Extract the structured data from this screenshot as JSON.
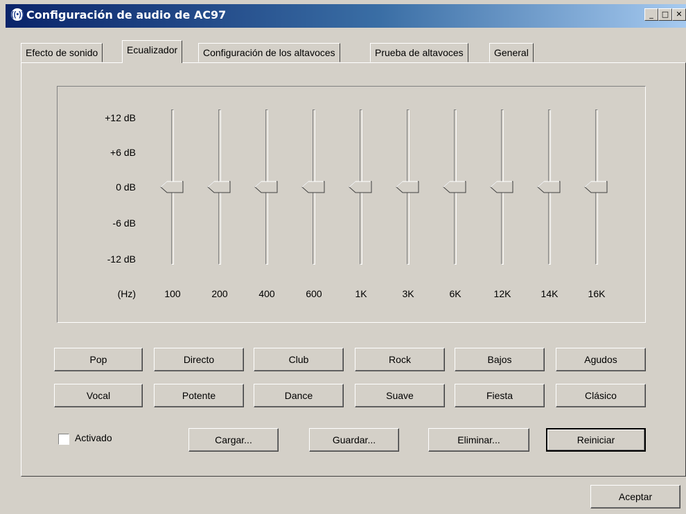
{
  "window": {
    "title": "Configuración de audio de AC97",
    "icon": "speaker-waves-icon"
  },
  "tabs": [
    {
      "label": "Efecto de sonido",
      "active": false
    },
    {
      "label": "Ecualizador",
      "active": true
    },
    {
      "label": "Configuración de los altavoces",
      "active": false
    },
    {
      "label": "Prueba de altavoces",
      "active": false
    },
    {
      "label": "General",
      "active": false
    }
  ],
  "equalizer": {
    "db_labels": [
      "+12 dB",
      "+6 dB",
      "0 dB",
      "-6 dB",
      "-12 dB"
    ],
    "hz_label": "(Hz)",
    "bands": [
      {
        "label": "100",
        "value_db": 0
      },
      {
        "label": "200",
        "value_db": 0
      },
      {
        "label": "400",
        "value_db": 0
      },
      {
        "label": "600",
        "value_db": 0
      },
      {
        "label": "1K",
        "value_db": 0
      },
      {
        "label": "3K",
        "value_db": 0
      },
      {
        "label": "6K",
        "value_db": 0
      },
      {
        "label": "12K",
        "value_db": 0
      },
      {
        "label": "14K",
        "value_db": 0
      },
      {
        "label": "16K",
        "value_db": 0
      }
    ]
  },
  "presets_row1": [
    "Pop",
    "Directo",
    "Club",
    "Rock",
    "Bajos",
    "Agudos"
  ],
  "presets_row2": [
    "Vocal",
    "Potente",
    "Dance",
    "Suave",
    "Fiesta",
    "Clásico"
  ],
  "enabled_checkbox": {
    "label": "Activado",
    "checked": false
  },
  "actions": [
    "Cargar...",
    "Guardar...",
    "Eliminar...",
    "Reiniciar"
  ],
  "accept_button": "Aceptar"
}
